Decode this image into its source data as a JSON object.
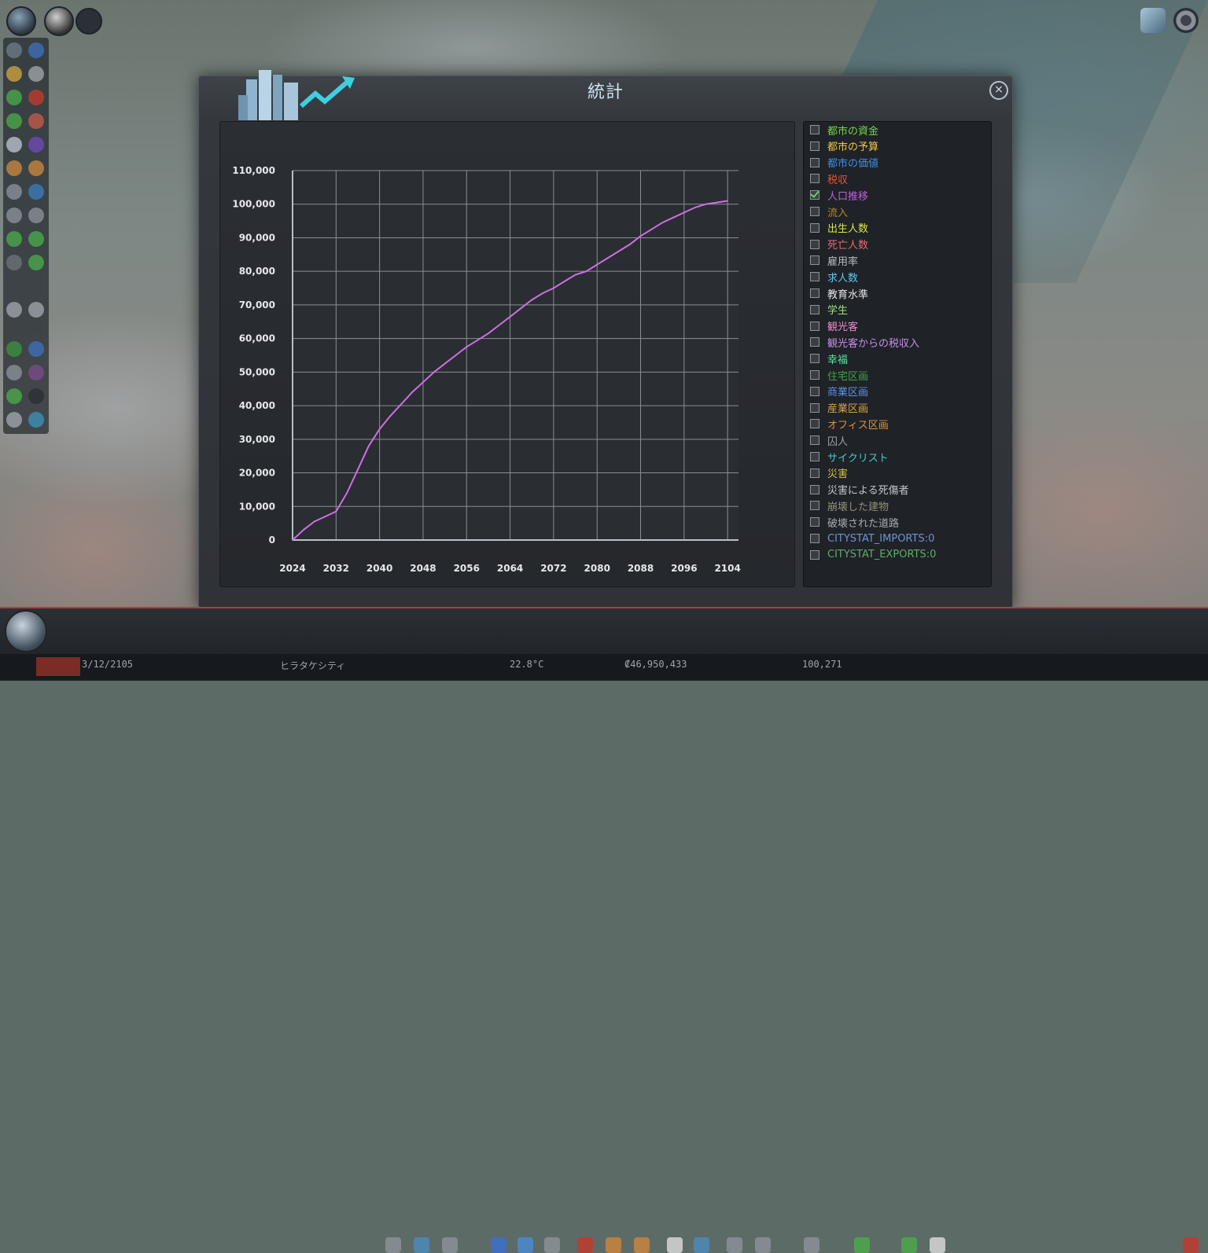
{
  "window": {
    "title": "統計",
    "close_label": "×"
  },
  "chart_data": {
    "type": "line",
    "xlabel": "",
    "ylabel": "",
    "x_ticks": [
      "2024",
      "2032",
      "2040",
      "2048",
      "2056",
      "2064",
      "2072",
      "2080",
      "2088",
      "2096",
      "2104"
    ],
    "y_ticks": [
      "0",
      "10,000",
      "20,000",
      "30,000",
      "40,000",
      "50,000",
      "60,000",
      "70,000",
      "80,000",
      "90,000",
      "100,000",
      "110,000"
    ],
    "xlim": [
      2024,
      2106
    ],
    "ylim": [
      0,
      110000
    ],
    "grid": true,
    "series": [
      {
        "name": "人口推移",
        "color": "#d06ee8",
        "x": [
          2024,
          2026,
          2028,
          2030,
          2032,
          2034,
          2036,
          2038,
          2040,
          2042,
          2044,
          2046,
          2048,
          2050,
          2052,
          2054,
          2056,
          2058,
          2060,
          2062,
          2064,
          2066,
          2068,
          2070,
          2072,
          2074,
          2076,
          2078,
          2080,
          2082,
          2084,
          2086,
          2088,
          2090,
          2092,
          2094,
          2096,
          2098,
          2100,
          2102,
          2104
        ],
        "y": [
          0,
          3000,
          5500,
          7000,
          8500,
          14000,
          21000,
          28000,
          33000,
          37000,
          40500,
          44000,
          47000,
          50000,
          52500,
          55000,
          57500,
          59500,
          61500,
          64000,
          66500,
          69000,
          71500,
          73500,
          75000,
          77000,
          79000,
          80000,
          82000,
          84000,
          86000,
          88000,
          90500,
          92500,
          94500,
          96000,
          97500,
          99000,
          100000,
          100500,
          101000
        ]
      }
    ]
  },
  "legend": {
    "items": [
      {
        "label": "都市の資金",
        "color": "#74d64a",
        "checked": false
      },
      {
        "label": "都市の予算",
        "color": "#f0c64a",
        "checked": false
      },
      {
        "label": "都市の価値",
        "color": "#3d8fe8",
        "checked": false
      },
      {
        "label": "税収",
        "color": "#e8543b",
        "checked": false
      },
      {
        "label": "人口推移",
        "color": "#c05ee0",
        "checked": true
      },
      {
        "label": "流入",
        "color": "#b9862e",
        "checked": false
      },
      {
        "label": "出生人数",
        "color": "#d8e64a",
        "checked": false
      },
      {
        "label": "死亡人数",
        "color": "#e86a74",
        "checked": false
      },
      {
        "label": "雇用率",
        "color": "#b9bfc4",
        "checked": false
      },
      {
        "label": "求人数",
        "color": "#5fc7f0",
        "checked": false
      },
      {
        "label": "教育水準",
        "color": "#e6e6e6",
        "checked": false
      },
      {
        "label": "学生",
        "color": "#9fe08a",
        "checked": false
      },
      {
        "label": "観光客",
        "color": "#f08ad0",
        "checked": false
      },
      {
        "label": "観光客からの税収入",
        "color": "#c890e8",
        "checked": false
      },
      {
        "label": "幸福",
        "color": "#5ee8a4",
        "checked": false
      },
      {
        "label": "住宅区画",
        "color": "#3fa34d",
        "checked": false
      },
      {
        "label": "商業区画",
        "color": "#5b8fe6",
        "checked": false
      },
      {
        "label": "産業区画",
        "color": "#d8a24a",
        "checked": false
      },
      {
        "label": "オフィス区画",
        "color": "#e6912e",
        "checked": false
      },
      {
        "label": "囚人",
        "color": "#9aa0a6",
        "checked": false
      },
      {
        "label": "サイクリスト",
        "color": "#4ac8d6",
        "checked": false
      },
      {
        "label": "災害",
        "color": "#d6c04a",
        "checked": false
      },
      {
        "label": "災害による死傷者",
        "color": "#c4c8cc",
        "checked": false
      },
      {
        "label": "崩壊した建物",
        "color": "#8f9378",
        "checked": false
      },
      {
        "label": "破壊された道路",
        "color": "#a8acb0",
        "checked": false
      },
      {
        "label": "CITYSTAT_IMPORTS:0",
        "color": "#6f93d6",
        "checked": false
      },
      {
        "label": "CITYSTAT_EXPORTS:0",
        "color": "#5fae6a",
        "checked": false
      }
    ]
  },
  "status_bar": {
    "date": "3/12/2105",
    "city_name": "ヒラタケシティ",
    "temperature": "22.8°C",
    "money": "₡46,950,433",
    "population": "100,271"
  }
}
